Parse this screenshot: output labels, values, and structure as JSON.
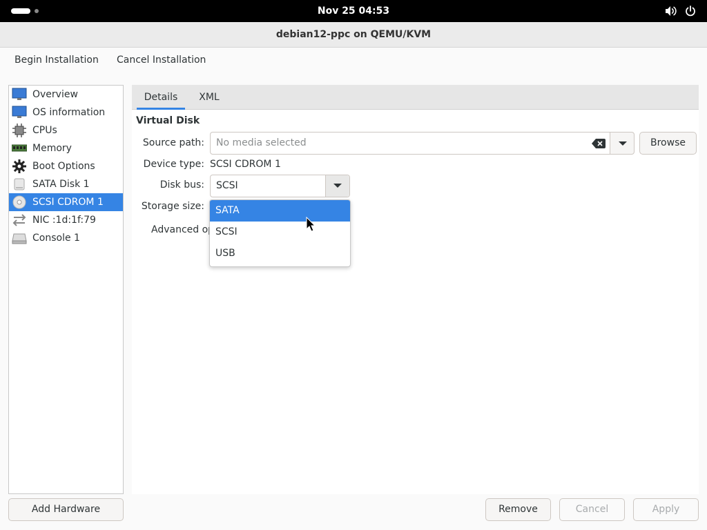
{
  "topbar": {
    "clock": "Nov 25  04:53",
    "icons": [
      "volume-icon",
      "power-icon"
    ]
  },
  "window": {
    "title": "debian12-ppc on QEMU/KVM"
  },
  "toolbar": {
    "begin_label": "Begin Installation",
    "cancel_label": "Cancel Installation"
  },
  "sidebar": {
    "items": [
      {
        "label": "Overview",
        "icon": "monitor-icon"
      },
      {
        "label": "OS information",
        "icon": "monitor-icon"
      },
      {
        "label": "CPUs",
        "icon": "cpu-chip-icon"
      },
      {
        "label": "Memory",
        "icon": "memory-module-icon"
      },
      {
        "label": "Boot Options",
        "icon": "gear-icon"
      },
      {
        "label": "SATA Disk 1",
        "icon": "hard-disk-icon"
      },
      {
        "label": "SCSI CDROM 1",
        "icon": "cdrom-icon",
        "selected": true
      },
      {
        "label": "NIC :1d:1f:79",
        "icon": "network-arrows-icon"
      },
      {
        "label": "Console 1",
        "icon": "console-icon"
      }
    ],
    "add_label": "Add Hardware"
  },
  "tabs": [
    {
      "label": "Details",
      "active": true
    },
    {
      "label": "XML",
      "active": false
    }
  ],
  "details": {
    "section_title": "Virtual Disk",
    "source_path_label": "Source path:",
    "source_path_placeholder": "No media selected",
    "browse_label": "Browse",
    "device_type_label": "Device type:",
    "device_type_value": "SCSI CDROM 1",
    "disk_bus_label": "Disk bus:",
    "disk_bus_value": "SCSI",
    "storage_size_label": "Storage size:",
    "advanced_label": "Advanced options"
  },
  "dropdown": {
    "options": [
      "SATA",
      "SCSI",
      "USB"
    ],
    "highlighted": "SATA"
  },
  "buttons": {
    "remove": "Remove",
    "cancel": "Cancel",
    "apply": "Apply"
  },
  "colors": {
    "accent": "#3584e4",
    "topbar": "#000000"
  }
}
